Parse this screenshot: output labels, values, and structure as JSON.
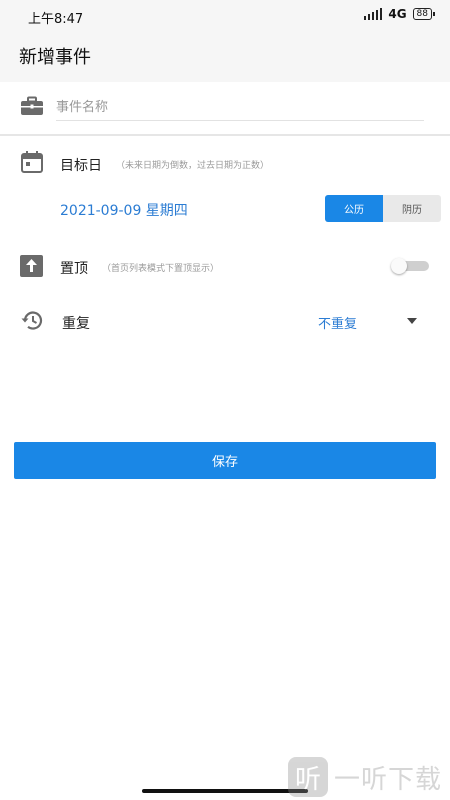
{
  "status_bar": {
    "time": "上午8:47",
    "network": "4G",
    "battery": "88"
  },
  "header": {
    "title": "新增事件"
  },
  "event_name": {
    "placeholder": "事件名称",
    "value": ""
  },
  "target_date": {
    "label": "目标日",
    "hint": "（未来日期为倒数，过去日期为正数）",
    "date_text": "2021-09-09  星期四",
    "calendar_options": [
      {
        "label": "公历",
        "selected": true
      },
      {
        "label": "阴历",
        "selected": false
      }
    ]
  },
  "pin_top": {
    "label": "置顶",
    "hint": "（首页列表模式下置顶显示）",
    "enabled": false
  },
  "repeat": {
    "label": "重复",
    "value": "不重复"
  },
  "save_button": {
    "label": "保存"
  },
  "watermark": {
    "logo_char": "听",
    "text": "一听下载"
  },
  "colors": {
    "accent": "#1a87e6",
    "date_text": "#2b7cd3",
    "header_bg": "#f6f6f6"
  },
  "icons": {
    "name": "briefcase-icon",
    "target_date": "calendar-icon",
    "pin": "upload-arrow-icon",
    "repeat": "history-icon",
    "dropdown": "caret-down-icon"
  }
}
